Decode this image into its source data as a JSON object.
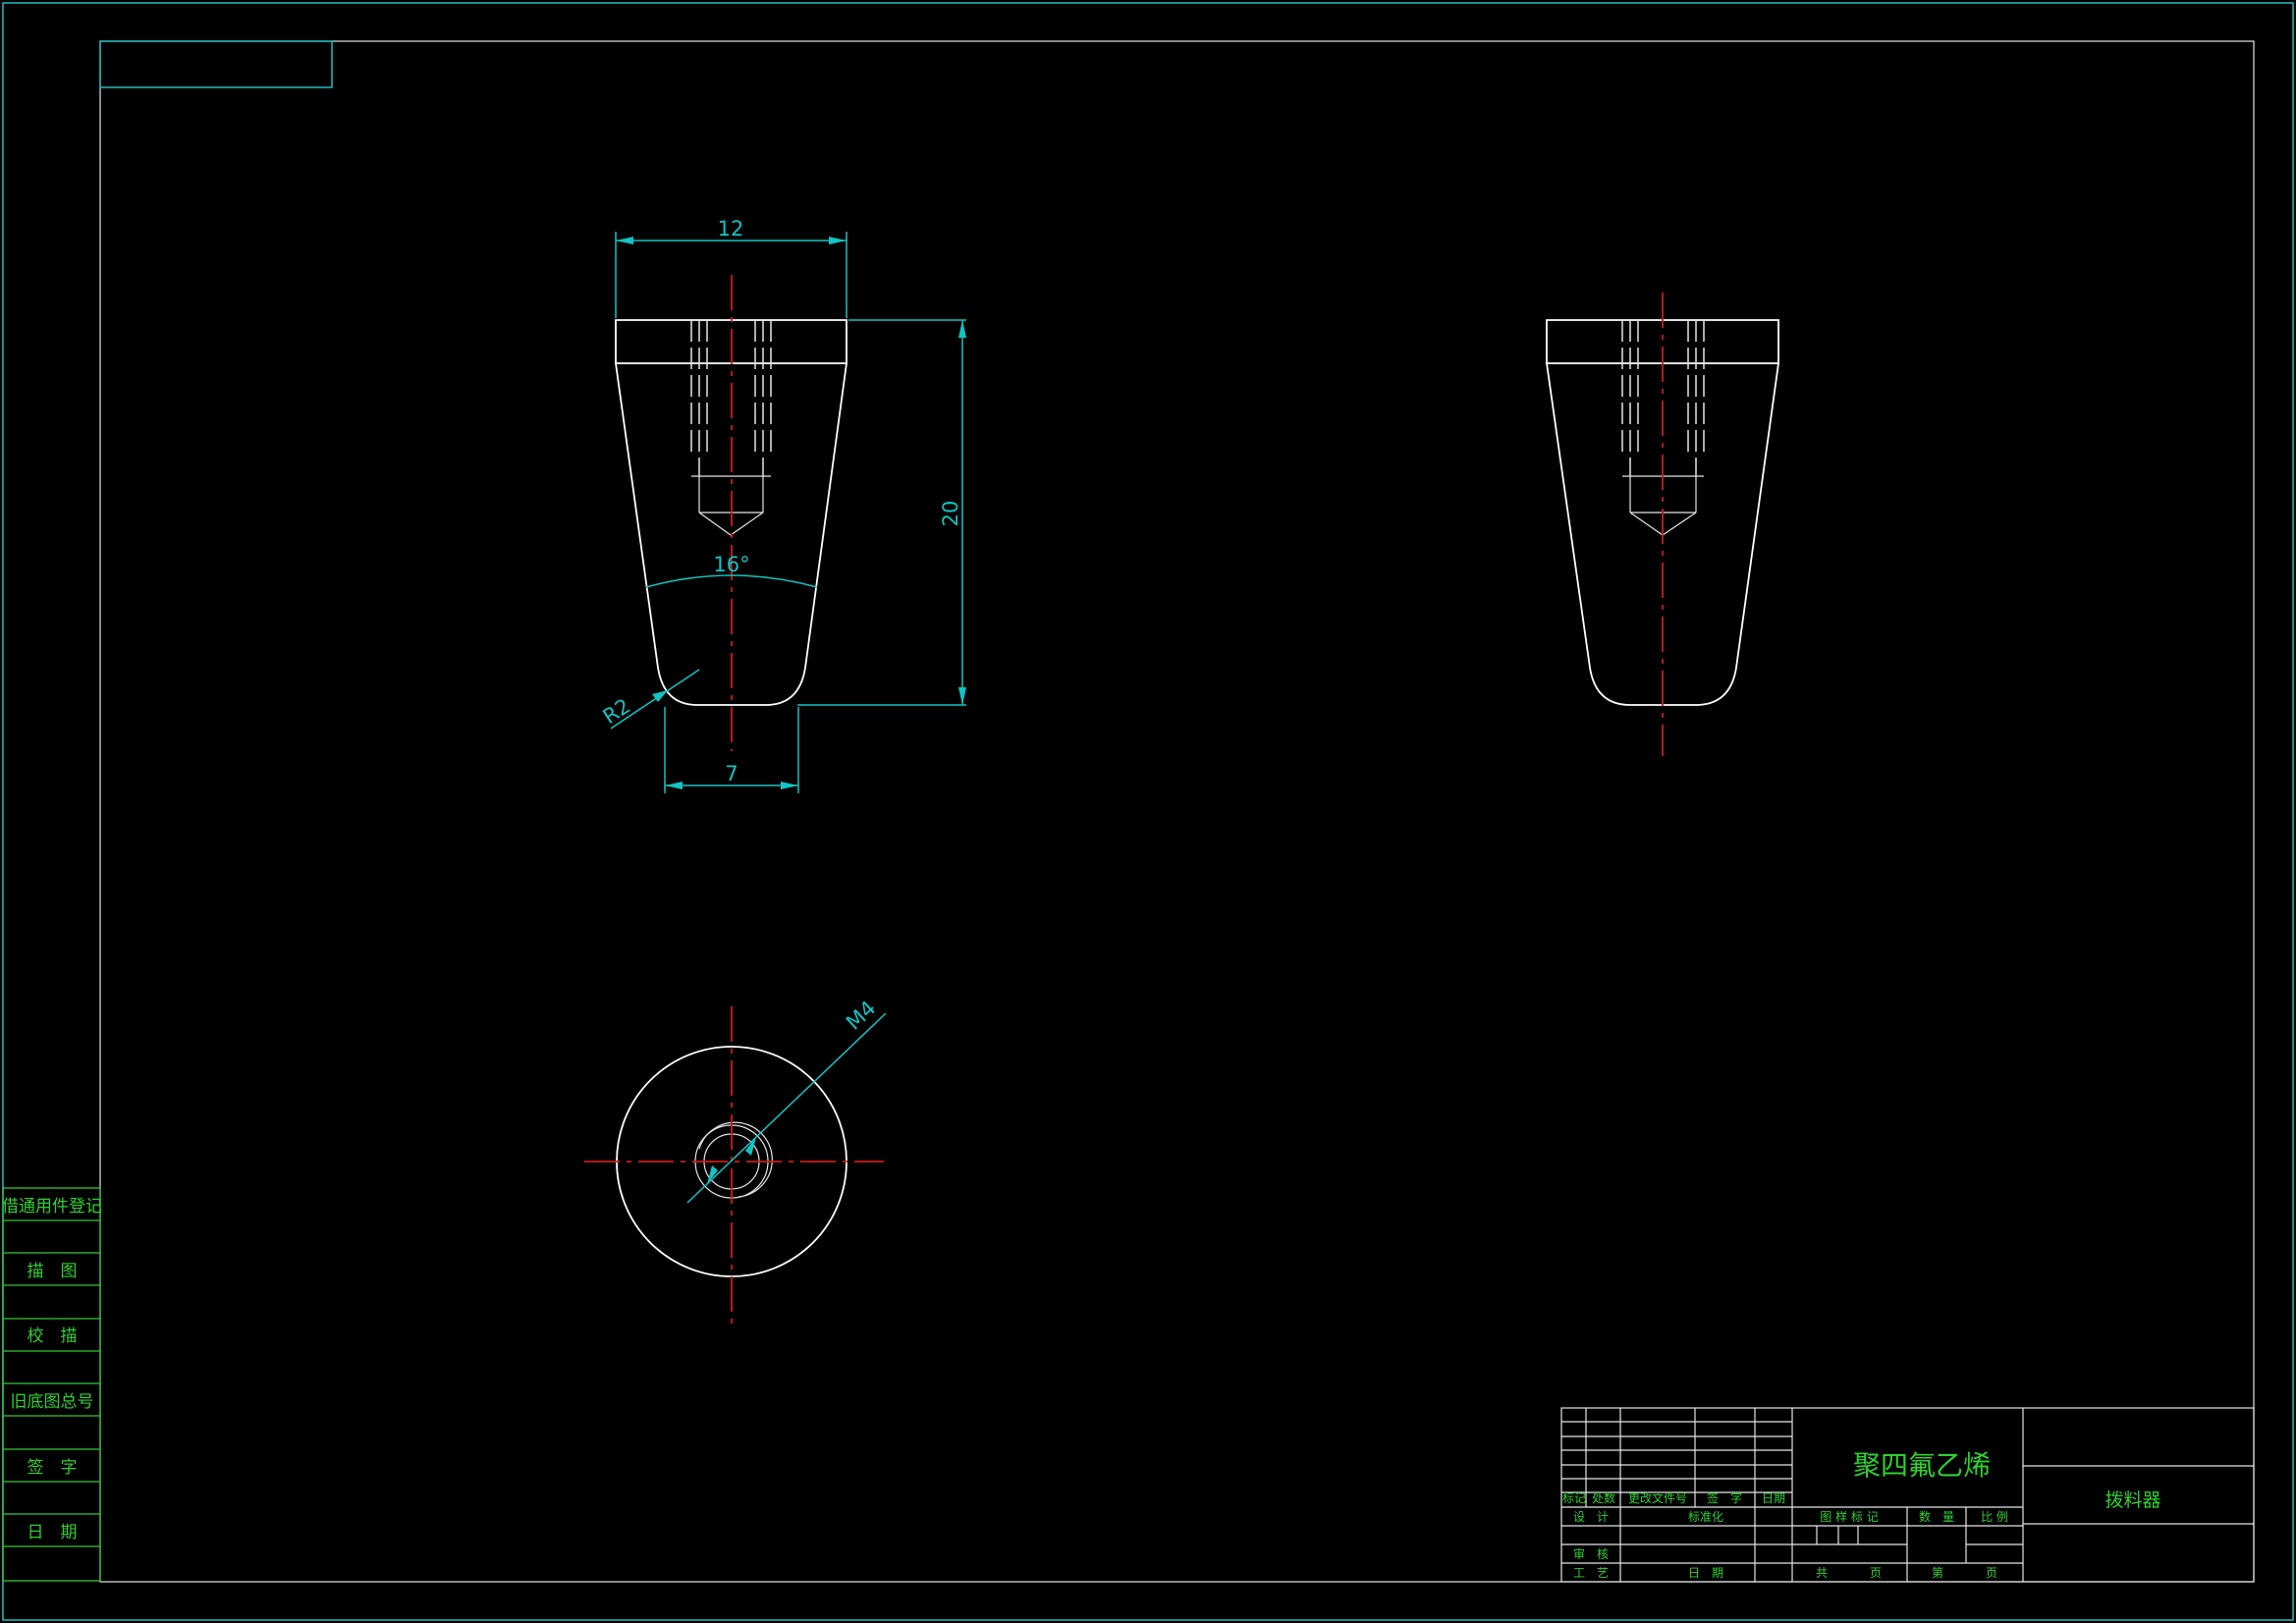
{
  "colors": {
    "background": "#000000",
    "frame": "#1fb3b3",
    "outline": "#ffffff",
    "centerline": "#d11a1a",
    "dimension": "#12c4c4",
    "label_text": "#2fd02f"
  },
  "dimensions": {
    "top_width": "12",
    "height": "20",
    "angle": "16°",
    "radius": "R2",
    "bottom_width": "7",
    "thread": "M4"
  },
  "left_strip": {
    "items": [
      "借通用件登记",
      "描　图",
      "校　描",
      "旧底图总号",
      "签　字",
      "日　期"
    ]
  },
  "title_block": {
    "material": "聚四氟乙烯",
    "part_name": "拨料器",
    "rev_headers": [
      "标记",
      "处数",
      "更改文件号",
      "签　字",
      "日期"
    ],
    "left_labels": {
      "design": "设　计",
      "standardize": "标准化",
      "review": "审　核",
      "process": "工　艺",
      "date": "日　期"
    },
    "mid_labels": {
      "stage_mark": "图 样 标 记",
      "quantity": "数　量",
      "scale": "比 例",
      "total": "共",
      "sheets": "页",
      "sheet_no": "第",
      "page": "页"
    }
  }
}
